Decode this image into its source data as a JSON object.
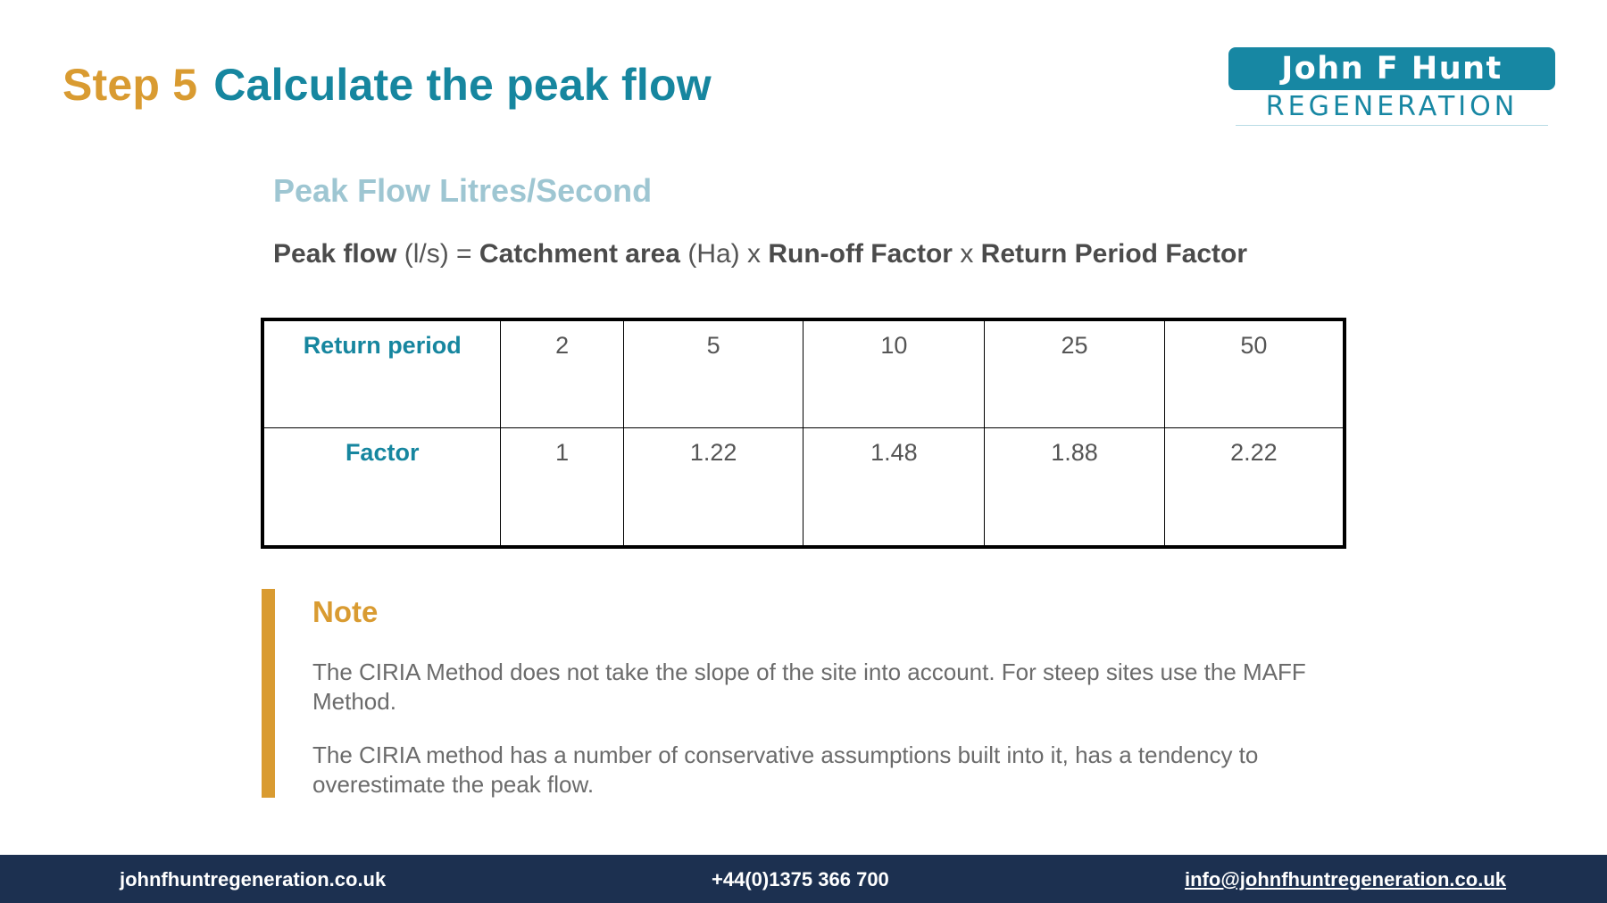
{
  "header": {
    "step_label": "Step 5",
    "title": "Calculate the peak flow"
  },
  "logo": {
    "line1": "John F Hunt",
    "line2": "REGENERATION",
    "colors": {
      "teal": "#1787a3"
    }
  },
  "section": {
    "subtitle": "Peak Flow Litres/Second",
    "formula": {
      "term1": "Peak flow",
      "unit1": " (l/s) = ",
      "term2": "Catchment area",
      "unit2": " (Ha) x ",
      "term3": "Run-off Factor",
      "op3": " x ",
      "term4": "Return Period Factor"
    }
  },
  "table": {
    "row1": {
      "header": "Return period",
      "values": [
        "2",
        "5",
        "10",
        "25",
        "50"
      ]
    },
    "row2": {
      "header": "Factor",
      "values": [
        "1",
        "1.22",
        "1.48",
        "1.88",
        "2.22"
      ]
    }
  },
  "note": {
    "title": "Note",
    "paragraph1": "The CIRIA Method does not take the slope of the site into account.  For steep sites use the MAFF Method.",
    "paragraph2": "The CIRIA method has a number of conservative assumptions built into it, has a tendency to overestimate the peak flow."
  },
  "footer": {
    "website": "johnfhuntregeneration.co.uk",
    "phone": "+44(0)1375 366 700",
    "email": "info@johnfhuntregeneration.co.uk"
  },
  "colors": {
    "accent_orange": "#d99b31",
    "accent_teal": "#16869f",
    "subtitle_blue": "#9ec6d2",
    "footer_navy": "#1c3050"
  }
}
